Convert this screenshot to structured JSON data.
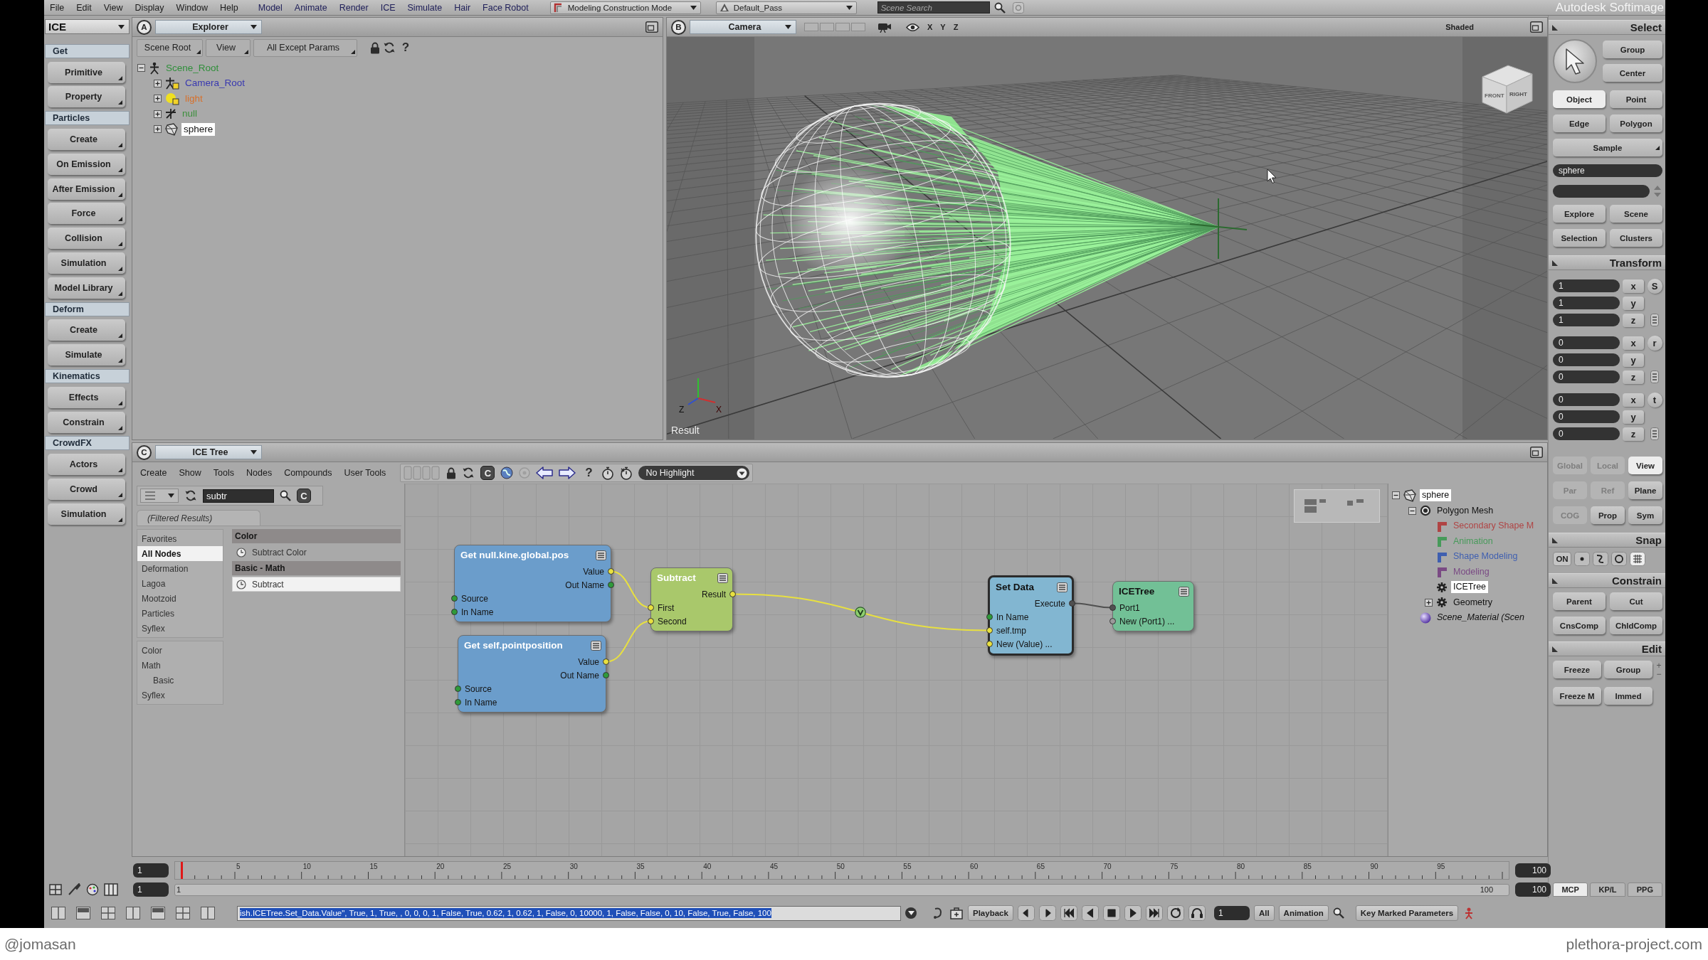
{
  "menu_bar": {
    "menus": [
      "File",
      "Edit",
      "View",
      "Display",
      "Window",
      "Help"
    ],
    "module_menus": [
      "Model",
      "Animate",
      "Render",
      "ICE",
      "Simulate",
      "Hair",
      "Face Robot"
    ],
    "mode": "Modeling Construction Mode",
    "pass": "Default_Pass",
    "search": {
      "placeholder": "Scene Search"
    },
    "product": "Autodesk Softimage"
  },
  "toolbar": {
    "module": "ICE",
    "items": [
      {
        "kind": "header",
        "label": "Get"
      },
      {
        "kind": "button",
        "label": "Primitive"
      },
      {
        "kind": "button",
        "label": "Property"
      },
      {
        "kind": "header",
        "label": "Particles"
      },
      {
        "kind": "button",
        "label": "Create"
      },
      {
        "kind": "button",
        "label": "On Emission"
      },
      {
        "kind": "button",
        "label": "After Emission"
      },
      {
        "kind": "button",
        "label": "Force"
      },
      {
        "kind": "button",
        "label": "Collision"
      },
      {
        "kind": "button",
        "label": "Simulation"
      },
      {
        "kind": "button",
        "label": "Model Library"
      },
      {
        "kind": "header",
        "label": "Deform"
      },
      {
        "kind": "button",
        "label": "Create"
      },
      {
        "kind": "button",
        "label": "Simulate"
      },
      {
        "kind": "header",
        "label": "Kinematics"
      },
      {
        "kind": "button",
        "label": "Effects"
      },
      {
        "kind": "button",
        "label": "Constrain"
      },
      {
        "kind": "header",
        "label": "CrowdFX"
      },
      {
        "kind": "button",
        "label": "Actors"
      },
      {
        "kind": "button",
        "label": "Crowd"
      },
      {
        "kind": "button",
        "label": "Simulation"
      }
    ]
  },
  "explorer": {
    "letter": "A",
    "view": "Explorer",
    "tools": [
      "Scene Root",
      "View",
      "All Except Params"
    ],
    "help": "?",
    "tree": [
      {
        "label": "Scene_Root",
        "kind": "model",
        "color": "#2f8f3a",
        "selected": false,
        "expanded": true,
        "children": [
          {
            "label": "Camera_Root",
            "kind": "camera",
            "color": "#3838b0",
            "selected": false,
            "expanded": false
          },
          {
            "label": "light",
            "kind": "light",
            "color": "#d8702a",
            "selected": false,
            "expanded": false
          },
          {
            "label": "null",
            "kind": "null",
            "color": "#3c8f3c",
            "selected": false,
            "expanded": false
          },
          {
            "label": "sphere",
            "kind": "mesh",
            "color": "#111111",
            "selected": true,
            "expanded": false
          }
        ]
      }
    ]
  },
  "viewport": {
    "letter": "B",
    "view": "Camera",
    "axes": [
      "X",
      "Y",
      "Z"
    ],
    "display_mode": "Shaded",
    "cube_faces": [
      "FRONT",
      "RIGHT"
    ],
    "gizmo_labels": [
      "Z",
      "X"
    ],
    "caption": "Result"
  },
  "ice_tree": {
    "letter": "C",
    "view": "ICE Tree",
    "menus": [
      "Create",
      "Show",
      "Tools",
      "Nodes",
      "Compounds",
      "User Tools"
    ],
    "toolbar_letter": "C",
    "help": "?",
    "highlight": "No Highlight",
    "search": {
      "value": "subtr",
      "clear": "C"
    },
    "results_tab": "(Filtered Results)",
    "category_groups": [
      [
        {
          "label": "Favorites",
          "selected": false
        },
        {
          "label": "All Nodes",
          "selected": true
        },
        {
          "label": "Deformation",
          "selected": false
        },
        {
          "label": "Lagoa",
          "selected": false
        },
        {
          "label": "Mootzoid",
          "selected": false
        },
        {
          "label": "Particles",
          "selected": false
        },
        {
          "label": "Syflex",
          "selected": false
        }
      ],
      [
        {
          "label": "Color",
          "selected": false
        },
        {
          "label": "Math",
          "selected": false,
          "children": [
            {
              "label": "Basic",
              "selected": false
            }
          ]
        },
        {
          "label": "Syflex",
          "selected": false
        }
      ]
    ],
    "results": [
      {
        "group": "Color",
        "items": [
          {
            "label": "Subtract Color",
            "selected": false
          }
        ]
      },
      {
        "group": "Basic - Math",
        "items": [
          {
            "label": "Subtract",
            "selected": true
          }
        ]
      }
    ],
    "nodes": [
      {
        "title": "Get null.kine.global.pos",
        "kind": "get",
        "selected": false,
        "outputs": [
          {
            "label": "Value",
            "color": "#e8e040"
          },
          {
            "label": "Out Name",
            "color": "#2f9a3a"
          }
        ],
        "inputs": [
          {
            "label": "Source",
            "color": "#2f9a3a"
          },
          {
            "label": "In Name",
            "color": "#2f9a3a"
          }
        ]
      },
      {
        "title": "Get self.pointposition",
        "kind": "get",
        "selected": false,
        "outputs": [
          {
            "label": "Value",
            "color": "#e8e040"
          },
          {
            "label": "Out Name",
            "color": "#2f9a3a"
          }
        ],
        "inputs": [
          {
            "label": "Source",
            "color": "#2f9a3a"
          },
          {
            "label": "In Name",
            "color": "#2f9a3a"
          }
        ]
      },
      {
        "title": "Subtract",
        "kind": "math",
        "selected": false,
        "outputs": [
          {
            "label": "Result",
            "color": "#e8e040"
          }
        ],
        "inputs": [
          {
            "label": "First",
            "color": "#e8e040"
          },
          {
            "label": "Second",
            "color": "#e8e040"
          }
        ]
      },
      {
        "title": "Set Data",
        "kind": "set",
        "selected": true,
        "outputs": [
          {
            "label": "Execute",
            "color": "#505050"
          }
        ],
        "inputs": [
          {
            "label": "In Name",
            "color": "#2f9a3a"
          },
          {
            "label": "self.tmp",
            "color": "#e8e040"
          },
          {
            "label": "New (Value) ...",
            "color": "#e8e040"
          }
        ]
      },
      {
        "title": "ICETree",
        "kind": "root",
        "selected": false,
        "inputs": [
          {
            "label": "Port1",
            "color": "#505050"
          },
          {
            "label": "New (Port1) ...",
            "color": "#9a9a9a"
          }
        ]
      }
    ],
    "tree": [
      {
        "label": "sphere",
        "kind": "mesh",
        "color": "#111111",
        "selected": true,
        "expanded": true,
        "children": [
          {
            "label": "Polygon Mesh",
            "kind": "polymesh",
            "color": "#111111",
            "selected": false,
            "expanded": true,
            "children": [
              {
                "label": "Secondary Shape M",
                "kind": "stack",
                "color": "#b04444",
                "selected": false
              },
              {
                "label": "Animation",
                "kind": "stack",
                "color": "#479a5a",
                "selected": false
              },
              {
                "label": "Shape Modeling",
                "kind": "stack",
                "color": "#3f5fb0",
                "selected": false
              },
              {
                "label": "Modeling",
                "kind": "stack",
                "color": "#7a4a84",
                "selected": false
              },
              {
                "label": "ICETree",
                "kind": "operator",
                "color": "#111111",
                "selected": true
              },
              {
                "label": "Geometry",
                "kind": "operator",
                "color": "#111111",
                "selected": false,
                "expanded": false
              }
            ]
          },
          {
            "label": "Scene_Material (Scen",
            "kind": "material",
            "color": "#111111",
            "selected": false
          }
        ]
      }
    ]
  },
  "timeline": {
    "start_field": "1",
    "ticks": [
      "5",
      "10",
      "15",
      "20",
      "25",
      "30",
      "35",
      "40",
      "45",
      "50",
      "55",
      "60",
      "65",
      "70",
      "75",
      "80",
      "85",
      "90",
      "95"
    ],
    "end_field": "100",
    "playhead": {
      "level": 0
    },
    "range_start_field": "1",
    "range_start": "1",
    "range_end": "100",
    "range_end_field": "100"
  },
  "command_bar": {
    "command": {
      "value": "ish.ICETree.Set_Data.Value\", True, 1, True, , 0, 0, 0, 1, False, True, 0.62, 1, 0.62, 1, False, 0, 10000, 1, False, False, 0, 10, False, True, False, 100",
      "text_selected": true
    },
    "playback": "Playback",
    "frame": "1",
    "range": "All",
    "animation": "Animation",
    "key_marked": "Key Marked Parameters"
  },
  "mcp": {
    "select": {
      "title": "Select",
      "top_buttons": [
        "Group",
        "Center"
      ],
      "filters": [
        {
          "label": "Object",
          "selected": true
        },
        {
          "label": "Point",
          "selected": false
        },
        {
          "label": "Edge",
          "selected": false
        },
        {
          "label": "Polygon",
          "selected": false
        }
      ],
      "sample": "Sample",
      "selection_name": "sphere",
      "buttons": [
        "Explore",
        "Scene",
        "Selection",
        "Clusters"
      ]
    },
    "transform": {
      "title": "Transform",
      "groups": [
        {
          "tool": "S",
          "values": [
            {
              "axis": "x",
              "value": "1"
            },
            {
              "axis": "y",
              "value": "1"
            },
            {
              "axis": "z",
              "value": "1"
            }
          ]
        },
        {
          "tool": "r",
          "values": [
            {
              "axis": "x",
              "value": "0"
            },
            {
              "axis": "y",
              "value": "0"
            },
            {
              "axis": "z",
              "value": "0"
            }
          ]
        },
        {
          "tool": "t",
          "values": [
            {
              "axis": "x",
              "value": "0"
            },
            {
              "axis": "y",
              "value": "0"
            },
            {
              "axis": "z",
              "value": "0"
            }
          ]
        }
      ],
      "mode_rows": [
        [
          {
            "label": "Global",
            "disabled": true,
            "selected": false
          },
          {
            "label": "Local",
            "disabled": true,
            "selected": false
          },
          {
            "label": "View",
            "disabled": false,
            "selected": true
          }
        ],
        [
          {
            "label": "Par",
            "disabled": true,
            "selected": false
          },
          {
            "label": "Ref",
            "disabled": true,
            "selected": false
          },
          {
            "label": "Plane",
            "disabled": false,
            "selected": false
          }
        ],
        [
          {
            "label": "COG",
            "disabled": true,
            "selected": false
          },
          {
            "label": "Prop",
            "disabled": false,
            "selected": false
          },
          {
            "label": "Sym",
            "disabled": false,
            "selected": false
          }
        ]
      ]
    },
    "snap": {
      "title": "Snap",
      "toggle": "ON"
    },
    "constrain": {
      "title": "Constrain",
      "buttons": [
        "Parent",
        "Cut",
        "CnsComp",
        "ChldComp"
      ]
    },
    "edit": {
      "title": "Edit",
      "buttons": [
        "Freeze",
        "Group",
        "Freeze M",
        "Immed"
      ],
      "add": "+",
      "remove": "−"
    },
    "tabs": [
      {
        "label": "MCP",
        "selected": true
      },
      {
        "label": "KP/L",
        "selected": false
      },
      {
        "label": "PPG",
        "selected": false
      }
    ]
  },
  "footer": {
    "credit": "@jomasan",
    "site": "plethora-project.com"
  }
}
